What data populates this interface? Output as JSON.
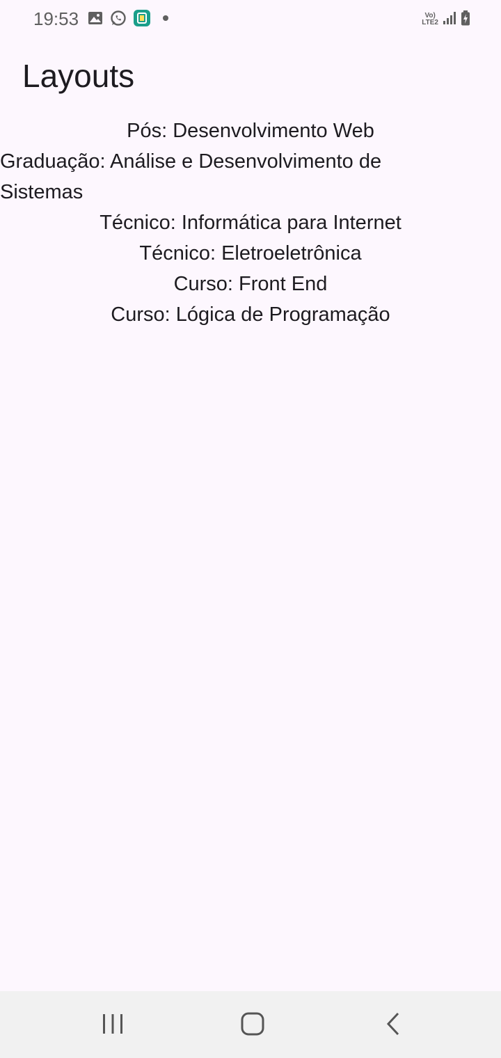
{
  "status_bar": {
    "time": "19:53",
    "left_icons": [
      "gallery-icon",
      "whatsapp-icon",
      "app-notification-icon",
      "dot-icon"
    ],
    "network_label_top": "Vo)",
    "network_label_bottom": "LTE2",
    "right_icons": [
      "volte-icon",
      "signal-icon",
      "battery-icon"
    ]
  },
  "app_bar": {
    "title": "Layouts"
  },
  "courses": [
    "Pós: Desenvolvimento Web",
    "Graduação: Análise e Desenvolvimento de Sistemas",
    "Técnico: Informática para Internet",
    "Técnico: Eletroeletrônica",
    "Curso: Front End",
    "Curso: Lógica de Programação"
  ],
  "nav_bar": {
    "buttons": [
      "recent-apps-icon",
      "home-icon",
      "back-icon"
    ]
  },
  "colors": {
    "background": "#fdf7fe",
    "text": "#1d1b20",
    "nav_background": "#f1f1f1",
    "accent_app_icon": "#1a9e8a"
  }
}
